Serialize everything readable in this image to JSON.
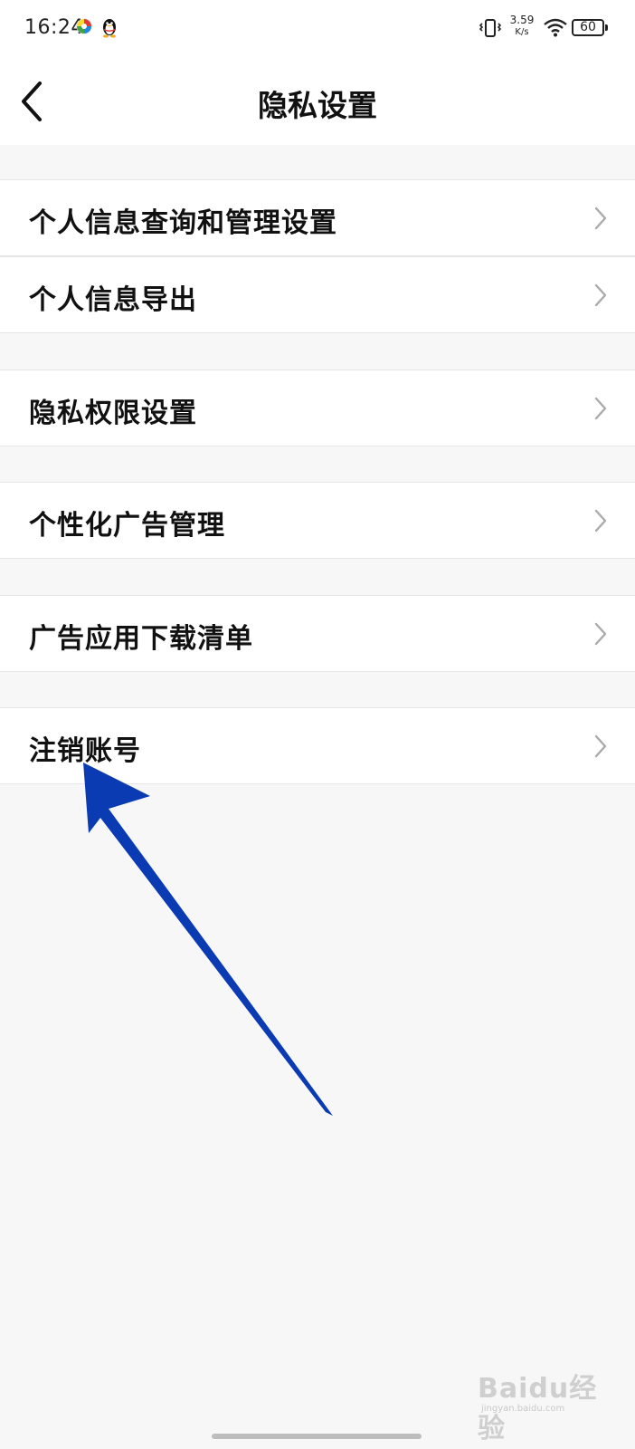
{
  "status_bar": {
    "time": "16:24",
    "net_speed_value": "3.59",
    "net_speed_unit": "K/s",
    "battery": "60",
    "icons": [
      "color-ball-app-icon",
      "qq-penguin-icon",
      "vibrate-icon",
      "wifi-icon",
      "battery-icon"
    ]
  },
  "header": {
    "back_icon": "chevron-left-icon",
    "title": "隐私设置"
  },
  "menu": {
    "items": [
      {
        "label": "个人信息查询和管理设置"
      },
      {
        "label": "个人信息导出"
      },
      {
        "label": "隐私权限设置"
      },
      {
        "label": "个性化广告管理"
      },
      {
        "label": "广告应用下载清单"
      },
      {
        "label": "注销账号"
      }
    ],
    "chevron_icon": "chevron-right-icon"
  },
  "annotation": {
    "arrow_color": "#0a3bb3"
  },
  "watermark": {
    "brand": "Baidu经验",
    "url": "jingyan.baidu.com"
  }
}
